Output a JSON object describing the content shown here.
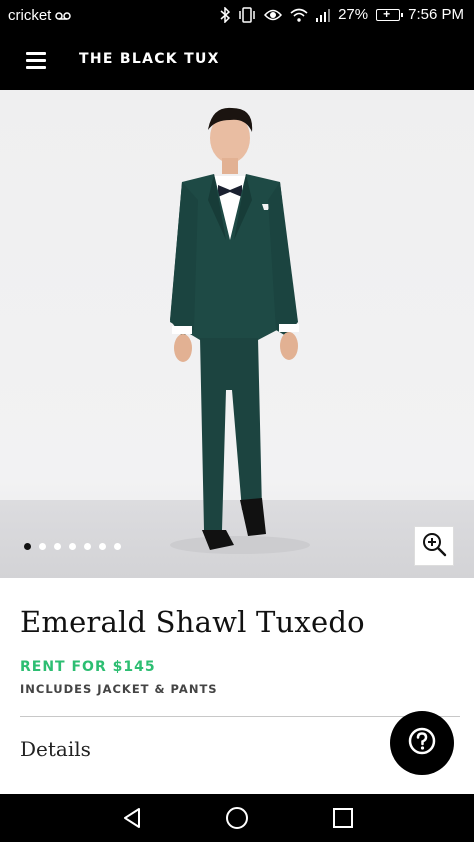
{
  "status_bar": {
    "carrier": "cricket",
    "battery": "27%",
    "time": "7:56 PM",
    "icons": [
      "voicemail-icon",
      "bluetooth-icon",
      "vibrate-icon",
      "eye-icon",
      "wifi-icon",
      "signal-icon",
      "battery-charging-icon"
    ]
  },
  "app_bar": {
    "brand": "THE BLACK TUX",
    "menu_icon": "hamburger-menu-icon"
  },
  "gallery": {
    "image_subject": "Emerald Shawl Tuxedo model photo",
    "total_images": 7,
    "active_index": 0,
    "zoom_icon": "zoom-in-icon"
  },
  "product": {
    "title": "Emerald Shawl Tuxedo",
    "rent_label": "RENT FOR $145",
    "includes": "INCLUDES JACKET & PANTS",
    "details_label": "Details",
    "help_icon": "help-question-icon"
  },
  "nav_bar": {
    "icons": [
      "back-icon",
      "home-icon",
      "recents-icon"
    ]
  },
  "colors": {
    "brand_bar": "#000000",
    "rent_green": "#2dbe72",
    "suit_green": "#1e4a45"
  }
}
